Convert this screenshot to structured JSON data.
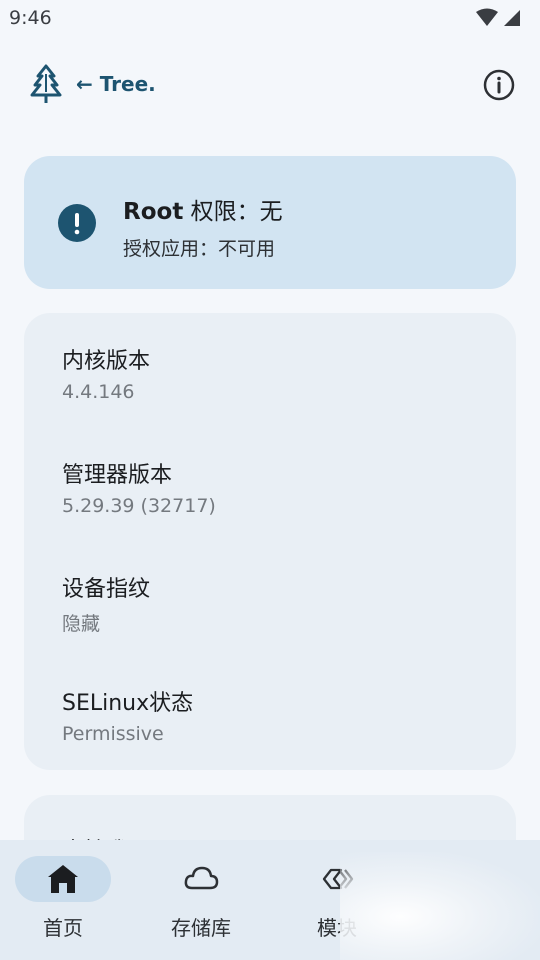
{
  "status_bar": {
    "time": "9:46",
    "icons": [
      "wifi-icon",
      "cell-signal-icon"
    ]
  },
  "app_bar": {
    "title": "← Tree.",
    "logo_icon": "tree-icon",
    "action_icon": "info-icon"
  },
  "root_status": {
    "title_bold": "Root",
    "title_rest": " 权限：无",
    "subtitle": "授权应用：不可用",
    "icon": "alert-circle-icon",
    "color": "#1d5470"
  },
  "info": {
    "items": [
      {
        "label": "内核版本",
        "value": "4.4.146"
      },
      {
        "label": "管理器版本",
        "value": "5.29.39 (32717)"
      },
      {
        "label": "设备指纹",
        "value": "隐藏"
      },
      {
        "label": "SELinux状态",
        "value": "Permissive"
      }
    ]
  },
  "next_card": {
    "label": "支持我"
  },
  "bottom_nav": {
    "items": [
      {
        "label": "首页",
        "icon": "home-icon",
        "active": true
      },
      {
        "label": "存储库",
        "icon": "cloud-icon",
        "active": false
      },
      {
        "label": "模块",
        "icon": "modules-icon",
        "active": false
      }
    ]
  },
  "colors": {
    "accent": "#1d5470",
    "background": "#f4f7fb",
    "card": "#e9eff5",
    "root_card": "#d2e4f2",
    "nav": "#e3ebf3",
    "nav_active_pill": "#c9dcec"
  }
}
